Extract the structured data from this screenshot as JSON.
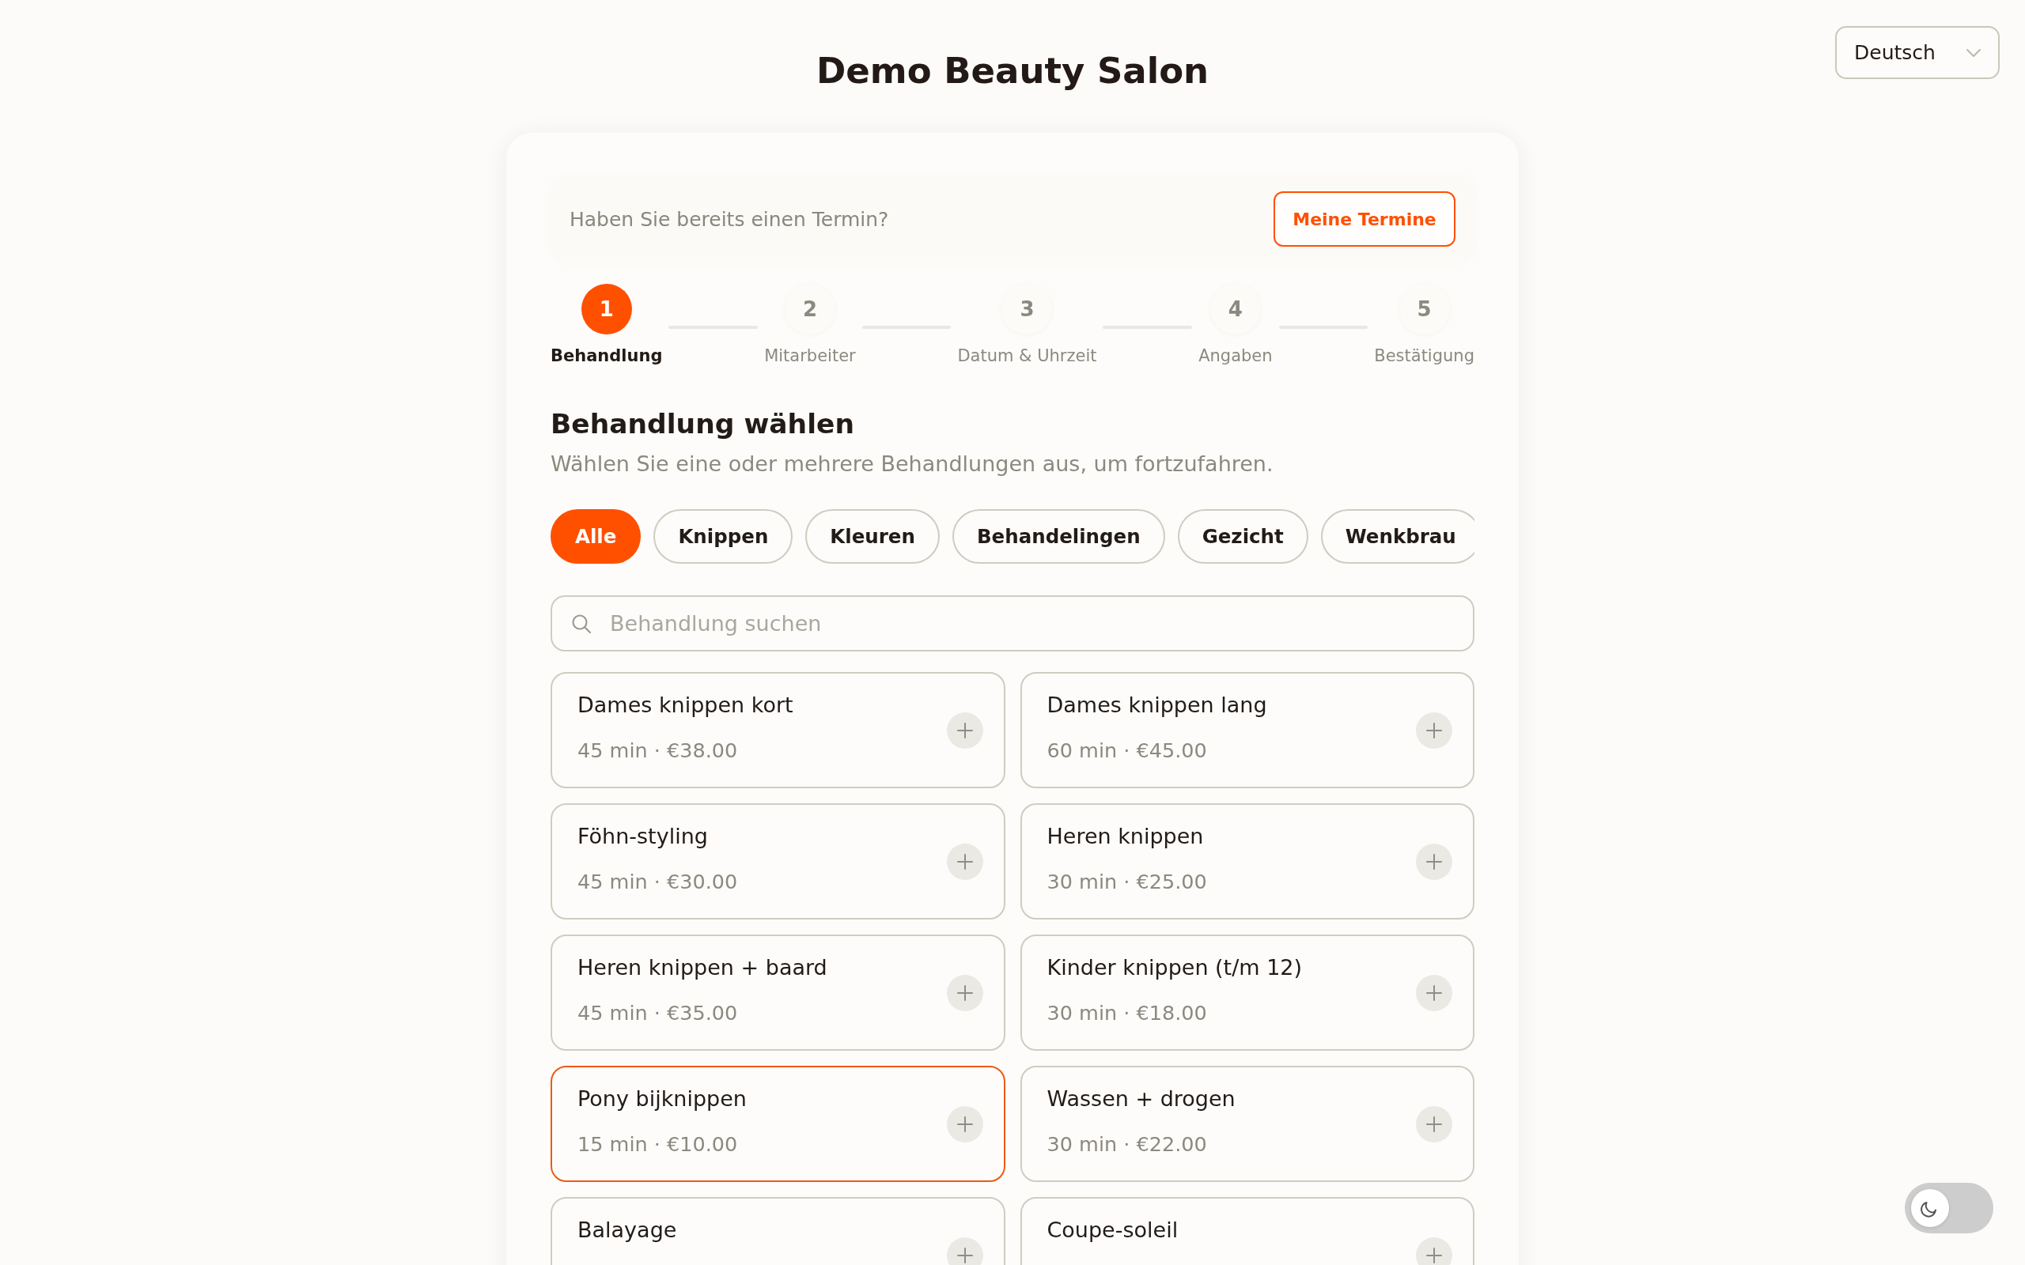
{
  "language_select": {
    "value": "Deutsch"
  },
  "title": "Demo Beauty Salon",
  "appointment_banner": {
    "text": "Haben Sie bereits einen Termin?",
    "button": "Meine Termine"
  },
  "steps": [
    {
      "number": "1",
      "label": "Behandlung",
      "current": true
    },
    {
      "number": "2",
      "label": "Mitarbeiter",
      "current": false
    },
    {
      "number": "3",
      "label": "Datum & Uhrzeit",
      "current": false
    },
    {
      "number": "4",
      "label": "Angaben",
      "current": false
    },
    {
      "number": "5",
      "label": "Bestätigung",
      "current": false
    }
  ],
  "section": {
    "heading": "Behandlung wählen",
    "description": "Wählen Sie eine oder mehrere Behandlungen aus, um fortzufahren."
  },
  "categories": [
    {
      "label": "Alle",
      "selected": true
    },
    {
      "label": "Knippen",
      "selected": false
    },
    {
      "label": "Kleuren",
      "selected": false
    },
    {
      "label": "Behandelingen",
      "selected": false
    },
    {
      "label": "Gezicht",
      "selected": false
    },
    {
      "label": "Wenkbrau",
      "selected": false
    }
  ],
  "search": {
    "placeholder": "Behandlung suchen"
  },
  "services": [
    {
      "name": "Dames knippen kort",
      "details": "45 min · €38.00",
      "selected": false
    },
    {
      "name": "Dames knippen lang",
      "details": "60 min · €45.00",
      "selected": false
    },
    {
      "name": "Föhn-styling",
      "details": "45 min · €30.00",
      "selected": false
    },
    {
      "name": "Heren knippen",
      "details": "30 min · €25.00",
      "selected": false
    },
    {
      "name": "Heren knippen + baard",
      "details": "45 min · €35.00",
      "selected": false
    },
    {
      "name": "Kinder knippen (t/m 12)",
      "details": "30 min · €18.00",
      "selected": false
    },
    {
      "name": "Pony bijknippen",
      "details": "15 min · €10.00",
      "selected": true
    },
    {
      "name": "Wassen + drogen",
      "details": "30 min · €22.00",
      "selected": false
    },
    {
      "name": "Balayage",
      "selected": false
    },
    {
      "name": "Coupe-soleil",
      "selected": false
    }
  ],
  "dark_mode_toggle": {
    "on": false
  }
}
